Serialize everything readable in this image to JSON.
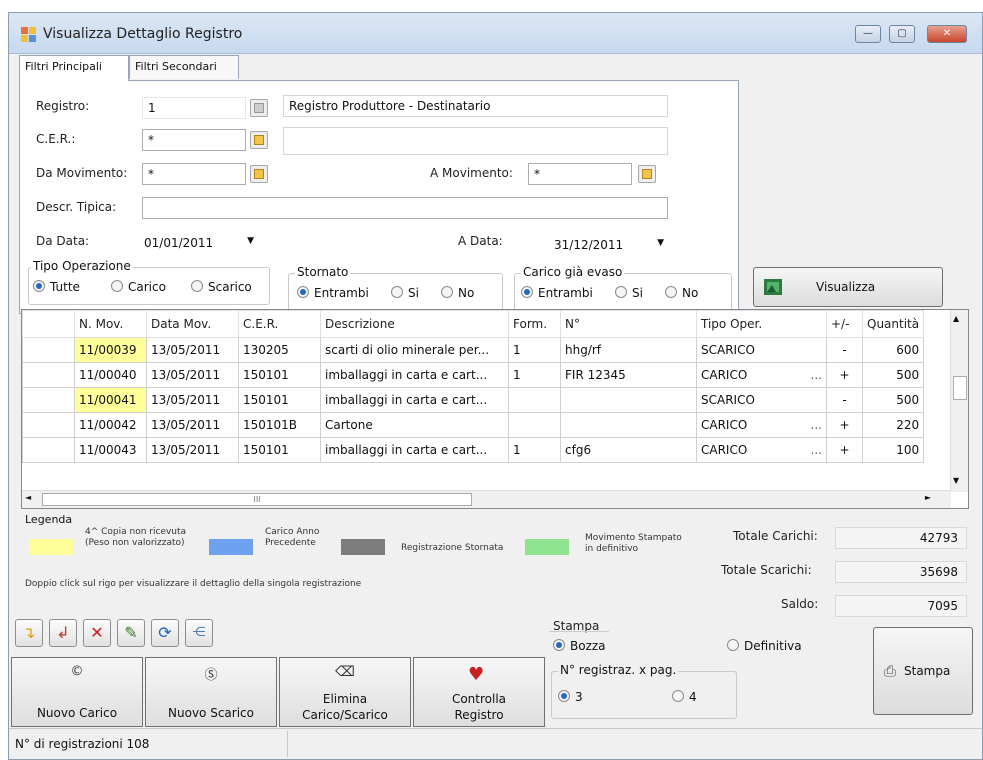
{
  "window": {
    "title": "Visualizza Dettaglio Registro",
    "min": "—",
    "max": "▢",
    "close": "✕"
  },
  "tabs": [
    {
      "label": "Filtri Principali"
    },
    {
      "label": "Filtri Secondari"
    }
  ],
  "filters": {
    "registro_label": "Registro:",
    "registro_value": "1",
    "registro_desc": "Registro Produttore - Destinatario",
    "cer_label": "C.E.R.:",
    "cer_value": "*",
    "da_mov_label": "Da Movimento:",
    "da_mov_value": "*",
    "a_mov_label": "A Movimento:",
    "a_mov_value": "*",
    "descr_label": "Descr. Tipica:",
    "descr_value": "",
    "da_data_label": "Da Data:",
    "da_data_value": "01/01/2011",
    "a_data_label": "A Data:",
    "a_data_value": "31/12/2011",
    "tipo_op": {
      "caption": "Tipo Operazione",
      "opts": [
        "Tutte",
        "Carico",
        "Scarico"
      ]
    },
    "stornato": {
      "caption": "Stornato",
      "opts": [
        "Entrambi",
        "Si",
        "No"
      ]
    },
    "evaso": {
      "caption": "Carico già evaso",
      "opts": [
        "Entrambi",
        "Si",
        "No"
      ]
    },
    "visualizza": "Visualizza"
  },
  "grid": {
    "headers": [
      "",
      "N. Mov.",
      "Data Mov.",
      "C.E.R.",
      "Descrizione",
      "Form.",
      "N°",
      "Tipo Oper.",
      "+/-",
      "Quantità"
    ],
    "rows": [
      {
        "nmov": "11/00039",
        "data": "13/05/2011",
        "cer": "130205",
        "descr": "scarti di olio minerale per...",
        "form": "1",
        "n": "hhg/rf",
        "tipo": "SCARICO",
        "dots": "",
        "sign": "-",
        "qta": "600",
        "yellow": true
      },
      {
        "nmov": "11/00040",
        "data": "13/05/2011",
        "cer": "150101",
        "descr": "imballaggi in carta e cart...",
        "form": "1",
        "n": "FIR 12345",
        "tipo": "CARICO",
        "dots": "...",
        "sign": "+",
        "qta": "500",
        "yellow": false
      },
      {
        "nmov": "11/00041",
        "data": "13/05/2011",
        "cer": "150101",
        "descr": "imballaggi in carta e cart...",
        "form": "",
        "n": "",
        "tipo": "SCARICO",
        "dots": "",
        "sign": "-",
        "qta": "500",
        "yellow": true
      },
      {
        "nmov": "11/00042",
        "data": "13/05/2011",
        "cer": "150101B",
        "descr": "Cartone",
        "form": "",
        "n": "",
        "tipo": "CARICO",
        "dots": "...",
        "sign": "+",
        "qta": "220",
        "yellow": false
      },
      {
        "nmov": "11/00043",
        "data": "13/05/2011",
        "cer": "150101",
        "descr": "imballaggi in carta e cart...",
        "form": "1",
        "n": "cfg6",
        "tipo": "CARICO",
        "dots": "...",
        "sign": "+",
        "qta": "100",
        "yellow": false
      }
    ],
    "hscroll_thumb": "III"
  },
  "legend": {
    "title": "Legenda",
    "items": [
      {
        "color": "#ffff99",
        "text1": "4^ Copia non ricevuta",
        "text2": "(Peso non valorizzato)"
      },
      {
        "color": "#6ea1f0",
        "text1": "Carico Anno",
        "text2": "Precedente"
      },
      {
        "color": "#7d7d7d",
        "text1": "Registrazione Stornata",
        "text2": ""
      },
      {
        "color": "#8fe38f",
        "text1": "Movimento Stampato",
        "text2": "in definitivo"
      }
    ],
    "hint": "Doppio click sul rigo per visualizzare il dettaglio della singola registrazione"
  },
  "totals": {
    "carichi_label": "Totale Carichi:",
    "carichi": "42793",
    "scarichi_label": "Totale Scarichi:",
    "scarichi": "35698",
    "saldo_label": "Saldo:",
    "saldo": "7095"
  },
  "toolbar_icons": [
    "add-row-icon",
    "undo-row-icon",
    "delete-icon",
    "edit-icon",
    "refresh-icon",
    "tree-icon"
  ],
  "actions": {
    "nuovo_carico": "Nuovo Carico",
    "nuovo_scarico": "Nuovo Scarico",
    "elimina1": "Elimina",
    "elimina2": "Carico/Scarico",
    "controlla1": "Controlla",
    "controlla2": "Registro"
  },
  "stampa": {
    "caption": "Stampa",
    "bozza": "Bozza",
    "definitiva": "Definitiva",
    "nreg_caption": "N° registraz. x pag.",
    "opt3": "3",
    "opt4": "4",
    "button": "Stampa"
  },
  "status": {
    "text": "N° di registrazioni 108"
  }
}
